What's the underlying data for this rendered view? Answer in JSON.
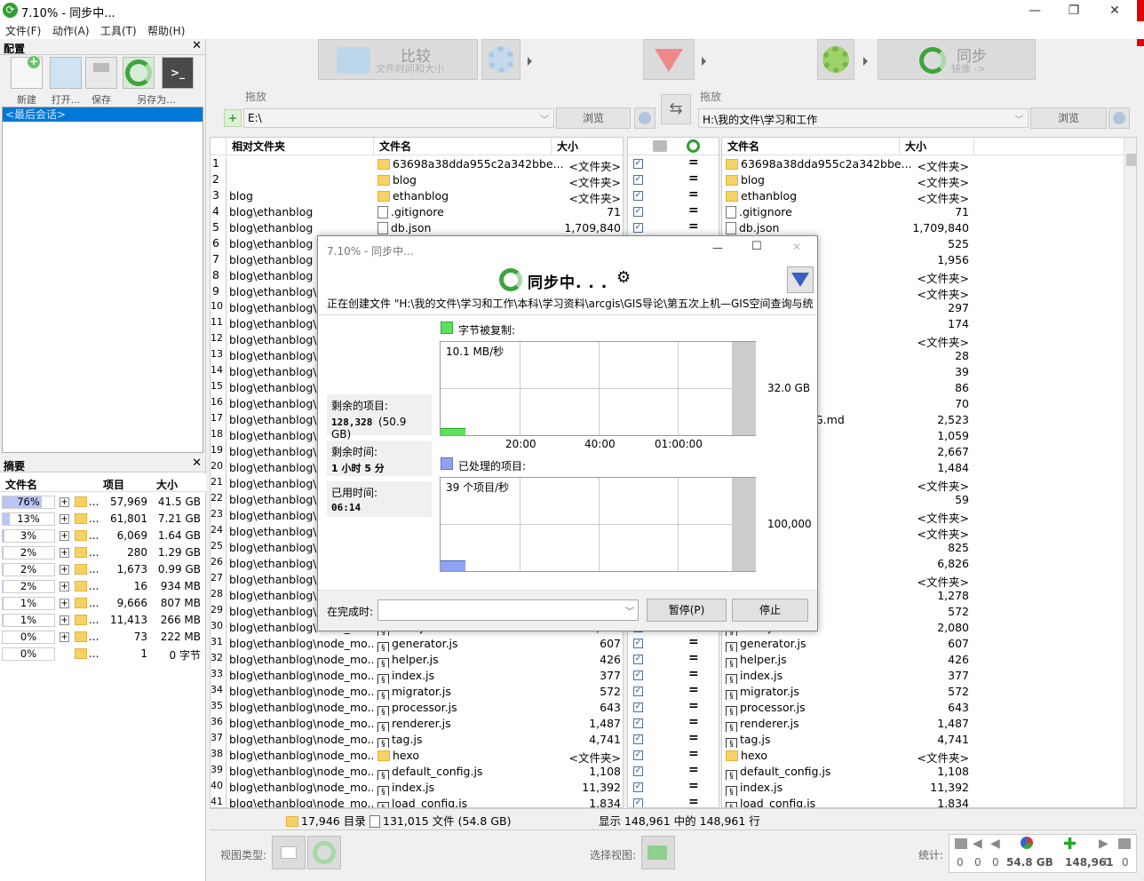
{
  "window": {
    "title": "7.10% - 同步中...",
    "min": "—",
    "restore": "❐",
    "close": "✕"
  },
  "menu": [
    "文件(F)",
    "动作(A)",
    "工具(T)",
    "帮助(H)"
  ],
  "config_panel": {
    "title": "配置",
    "close": "✕",
    "buttons": [
      "新建",
      "打开...",
      "保存",
      "另存为..."
    ],
    "item": "<最后会话>"
  },
  "summary_panel": {
    "title": "摘要",
    "close": "✕",
    "headers": [
      "文件名",
      "项目",
      "大小"
    ],
    "rows": [
      {
        "pct": "76%",
        "fill": 76,
        "items": "57,969",
        "size": "41.5 GB",
        "plus": true
      },
      {
        "pct": "13%",
        "fill": 13,
        "items": "61,801",
        "size": "7.21 GB",
        "plus": true
      },
      {
        "pct": "3%",
        "fill": 3,
        "items": "6,069",
        "size": "1.64 GB",
        "plus": true
      },
      {
        "pct": "2%",
        "fill": 2,
        "items": "280",
        "size": "1.29 GB",
        "plus": true
      },
      {
        "pct": "2%",
        "fill": 2,
        "items": "1,673",
        "size": "0.99 GB",
        "plus": true
      },
      {
        "pct": "2%",
        "fill": 2,
        "items": "16",
        "size": "934 MB",
        "plus": true
      },
      {
        "pct": "1%",
        "fill": 1,
        "items": "9,666",
        "size": "807 MB",
        "plus": true
      },
      {
        "pct": "1%",
        "fill": 1,
        "items": "11,413",
        "size": "266 MB",
        "plus": true
      },
      {
        "pct": "0%",
        "fill": 0,
        "items": "73",
        "size": "222 MB",
        "plus": true
      },
      {
        "pct": "0%",
        "fill": 0,
        "items": "1",
        "size": "0 字节",
        "plus": false
      }
    ],
    "ellipsis": "..."
  },
  "toolbar": {
    "compare_title": "比较",
    "compare_sub": "文件时间和大小",
    "sync_title": "同步",
    "sync_sub": "镜像 ->"
  },
  "left_path": {
    "label": "拖放",
    "value": "E:\\",
    "browse": "浏览"
  },
  "right_path": {
    "label": "拖放",
    "value": "H:\\我的文件\\学习和工作",
    "browse": "浏览"
  },
  "grid_left": {
    "headers": [
      "相对文件夹",
      "文件名",
      "大小"
    ]
  },
  "grid_right": {
    "headers": [
      "文件名",
      "大小"
    ]
  },
  "rows": [
    {
      "n": "1",
      "folder": "",
      "name": "63698a38dda955c2a342bbe...",
      "size": "<文件夹>",
      "rsize": "<文件夹>",
      "type": "folder"
    },
    {
      "n": "2",
      "folder": "",
      "name": "blog",
      "size": "<文件夹>",
      "rsize": "<文件夹>",
      "type": "folder"
    },
    {
      "n": "3",
      "folder": "blog",
      "name": "ethanblog",
      "size": "<文件夹>",
      "rsize": "<文件夹>",
      "type": "folder"
    },
    {
      "n": "4",
      "folder": "blog\\ethanblog",
      "name": ".gitignore",
      "size": "71",
      "rsize": "71",
      "type": "file"
    },
    {
      "n": "5",
      "folder": "blog\\ethanblog",
      "name": "db.json",
      "size": "1,709,840",
      "rsize": "1,709,840",
      "type": "file"
    },
    {
      "n": "6",
      "folder": "blog\\ethanblog",
      "name": "",
      "size": "",
      "rsize": "525",
      "type": "hidden"
    },
    {
      "n": "7",
      "folder": "blog\\ethanblog",
      "name": "",
      "size": "",
      "rsize": "1,956",
      "type": "hidden"
    },
    {
      "n": "8",
      "folder": "blog\\ethanblog",
      "name": "",
      "size": "",
      "rsize": "<文件夹>",
      "type": "hidden"
    },
    {
      "n": "9",
      "folder": "blog\\ethanblog\\n",
      "name": "",
      "size": "",
      "rsize": "<文件夹>",
      "type": "hidden"
    },
    {
      "n": "10",
      "folder": "blog\\ethanblog\\n",
      "name": "",
      "size": "",
      "rsize": "297",
      "type": "hidden"
    },
    {
      "n": "11",
      "folder": "blog\\ethanblog\\n",
      "name": "",
      "size": "",
      "rsize": "174",
      "type": "hidden"
    },
    {
      "n": "12",
      "folder": "blog\\ethanblog\\n",
      "name": "",
      "size": "",
      "rsize": "<文件夹>",
      "type": "hidden"
    },
    {
      "n": "13",
      "folder": "blog\\ethanblog\\n",
      "name": "",
      "size": "",
      "rsize": "28",
      "type": "hidden"
    },
    {
      "n": "14",
      "folder": "blog\\ethanblog\\n",
      "name": "",
      "size": "",
      "rsize": "39",
      "type": "hidden"
    },
    {
      "n": "15",
      "folder": "blog\\ethanblog\\n",
      "name": "",
      "size": "",
      "rsize": "86",
      "type": "hidden"
    },
    {
      "n": "16",
      "folder": "blog\\ethanblog\\n",
      "name": "",
      "size": "",
      "rsize": "70",
      "type": "hidden"
    },
    {
      "n": "17",
      "folder": "blog\\ethanblog\\n",
      "name": "",
      "size": "",
      "rsize": "2,523",
      "rname": "G.md",
      "type": "hidden"
    },
    {
      "n": "18",
      "folder": "blog\\ethanblog\\n",
      "name": "",
      "size": "",
      "rsize": "1,059",
      "type": "hidden"
    },
    {
      "n": "19",
      "folder": "blog\\ethanblog\\n",
      "name": "",
      "size": "",
      "rsize": "2,667",
      "type": "hidden"
    },
    {
      "n": "20",
      "folder": "blog\\ethanblog\\n",
      "name": "",
      "size": "",
      "rsize": "1,484",
      "type": "hidden"
    },
    {
      "n": "21",
      "folder": "blog\\ethanblog\\n",
      "name": "",
      "size": "",
      "rsize": "<文件夹>",
      "type": "hidden"
    },
    {
      "n": "22",
      "folder": "blog\\ethanblog\\n",
      "name": "",
      "size": "",
      "rsize": "59",
      "type": "hidden"
    },
    {
      "n": "23",
      "folder": "blog\\ethanblog\\n",
      "name": "",
      "size": "",
      "rsize": "<文件夹>",
      "type": "hidden"
    },
    {
      "n": "24",
      "folder": "blog\\ethanblog\\n",
      "name": "",
      "size": "",
      "rsize": "<文件夹>",
      "type": "hidden"
    },
    {
      "n": "25",
      "folder": "blog\\ethanblog\\n",
      "name": "",
      "size": "",
      "rsize": "825",
      "type": "hidden"
    },
    {
      "n": "26",
      "folder": "blog\\ethanblog\\n",
      "name": "",
      "size": "",
      "rsize": "6,826",
      "type": "hidden"
    },
    {
      "n": "27",
      "folder": "blog\\ethanblog\\n",
      "name": "",
      "size": "",
      "rsize": "<文件夹>",
      "type": "hidden"
    },
    {
      "n": "28",
      "folder": "blog\\ethanblog\\n",
      "name": "",
      "size": "",
      "rsize": "1,278",
      "type": "hidden"
    },
    {
      "n": "29",
      "folder": "blog\\ethanblog\\n",
      "name": "",
      "size": "",
      "rsize": "572",
      "type": "hidden"
    },
    {
      "n": "30",
      "folder": "blog\\ethanblog\\node_mo...",
      "name": "filter.js",
      "size": "2,080",
      "rsize": "2,080",
      "type": "js"
    },
    {
      "n": "31",
      "folder": "blog\\ethanblog\\node_mo...",
      "name": "generator.js",
      "size": "607",
      "rsize": "607",
      "type": "js"
    },
    {
      "n": "32",
      "folder": "blog\\ethanblog\\node_mo...",
      "name": "helper.js",
      "size": "426",
      "rsize": "426",
      "type": "js"
    },
    {
      "n": "33",
      "folder": "blog\\ethanblog\\node_mo...",
      "name": "index.js",
      "size": "377",
      "rsize": "377",
      "type": "js"
    },
    {
      "n": "34",
      "folder": "blog\\ethanblog\\node_mo...",
      "name": "migrator.js",
      "size": "572",
      "rsize": "572",
      "type": "js"
    },
    {
      "n": "35",
      "folder": "blog\\ethanblog\\node_mo...",
      "name": "processor.js",
      "size": "643",
      "rsize": "643",
      "type": "js"
    },
    {
      "n": "36",
      "folder": "blog\\ethanblog\\node_mo...",
      "name": "renderer.js",
      "size": "1,487",
      "rsize": "1,487",
      "type": "js"
    },
    {
      "n": "37",
      "folder": "blog\\ethanblog\\node_mo...",
      "name": "tag.js",
      "size": "4,741",
      "rsize": "4,741",
      "type": "js"
    },
    {
      "n": "38",
      "folder": "blog\\ethanblog\\node_mo...",
      "name": "hexo",
      "size": "<文件夹>",
      "rsize": "<文件夹>",
      "type": "folder"
    },
    {
      "n": "39",
      "folder": "blog\\ethanblog\\node_mo...",
      "name": "default_config.js",
      "size": "1,108",
      "rsize": "1,108",
      "type": "js"
    },
    {
      "n": "40",
      "folder": "blog\\ethanblog\\node_mo...",
      "name": "index.js",
      "size": "11,392",
      "rsize": "11,392",
      "type": "js"
    },
    {
      "n": "41",
      "folder": "blog\\ethanblog\\node_mo...",
      "name": "load_config.js",
      "size": "1,834",
      "rsize": "1,834",
      "type": "js"
    }
  ],
  "status": {
    "dirs": "17,946 目录",
    "files": "131,015 文件 (54.8 GB)",
    "shown": "显示 148,961 中的 148,961 行"
  },
  "bottom": {
    "view_type": "视图类型:",
    "select_view": "选择视图:",
    "stats": "统计:",
    "stat_values": [
      "0",
      "0",
      "0",
      "54.8 GB",
      "148,961",
      "0",
      "0"
    ]
  },
  "dialog": {
    "title": "7.10% - 同步中...",
    "heading": "同步中. . .",
    "current": "正在创建文件 \"H:\\我的文件\\学习和工作\\本科\\学习资料\\arcgis\\GIS导论\\第五次上机—GIS空间查询与统",
    "bytes_label": "字节被复制:",
    "speed": "10.1 MB/秒",
    "bytes_axis": "32.0 GB",
    "time_ticks": [
      "20:00",
      "40:00",
      "01:00:00"
    ],
    "items_label": "已处理的项目:",
    "items_speed": "39 个项目/秒",
    "items_axis": "100,000",
    "remaining_items_label": "剩余的项目:",
    "remaining_items": "128,328",
    "remaining_size": "(50.9 GB)",
    "remaining_time_label": "剩余时间:",
    "remaining_time": "1 小时 5 分",
    "elapsed_label": "已用时间:",
    "elapsed": "06:14",
    "on_complete_label": "在完成时:",
    "pause": "暂停(P)",
    "stop": "停止",
    "bytes_color": "#5ee25e",
    "items_color": "#8fa3f5"
  }
}
